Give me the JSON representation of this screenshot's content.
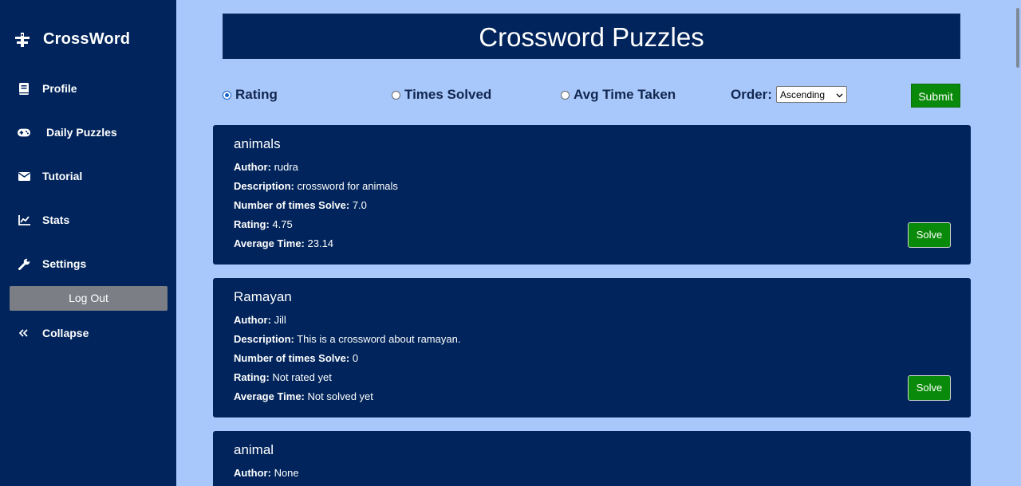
{
  "sidebar": {
    "brand": "CrossWord",
    "items": [
      {
        "label": "Profile",
        "icon": "book-icon"
      },
      {
        "label": "Daily Puzzles",
        "icon": "gamepad-icon"
      },
      {
        "label": "Tutorial",
        "icon": "envelope-icon"
      },
      {
        "label": "Stats",
        "icon": "chart-line-icon"
      },
      {
        "label": "Settings",
        "icon": "wrench-icon"
      }
    ],
    "logout": "Log Out",
    "collapse": "Collapse"
  },
  "header": {
    "title": "Crossword Puzzles"
  },
  "filters": {
    "options": [
      "Rating",
      "Times Solved",
      "Avg Time Taken"
    ],
    "selected": "Rating",
    "order_label": "Order:",
    "order_value": "Ascending",
    "submit": "Submit"
  },
  "labels": {
    "author": "Author:",
    "description": "Description:",
    "times": "Number of times Solve:",
    "rating": "Rating:",
    "avg": "Average Time:",
    "solve": "Solve"
  },
  "puzzles": [
    {
      "title": "animals",
      "author": "rudra",
      "description": "crossword for animals",
      "times": "7.0",
      "rating": "4.75",
      "avg": "23.14"
    },
    {
      "title": "Ramayan",
      "author": "Jill",
      "description": "This is a crossword about ramayan.",
      "times": "0",
      "rating": "Not rated yet",
      "avg": "Not solved yet"
    },
    {
      "title": "animal",
      "author": "None"
    }
  ],
  "colors": {
    "sidebar": "#00245b",
    "background": "#a8c8fb",
    "button": "#0a8a0a"
  }
}
